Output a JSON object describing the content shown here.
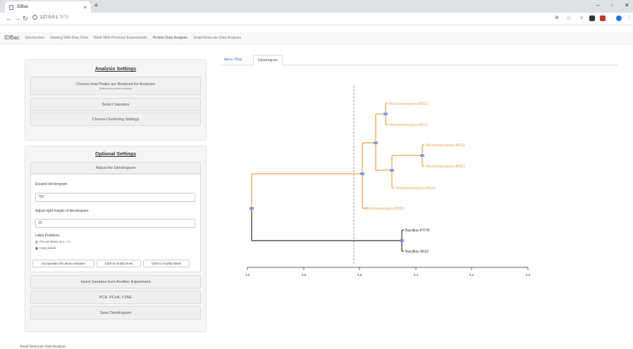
{
  "browser": {
    "tab_title": "IDBac",
    "tab_close": "×",
    "new_tab": "+",
    "url_host": "127.0.0.1",
    "url_port": ":7875",
    "win_min": "–",
    "win_max": "▫",
    "win_close": "✕"
  },
  "navbar": {
    "brand": "IDBac",
    "items": [
      "Introduction",
      "Starting With Raw Data",
      "Work With Previous Experiments",
      "Protein Data Analysis",
      "Small Molecule Data Analysis"
    ]
  },
  "analysis": {
    "title": "Analysis Settings",
    "peaks_btn": "Choose how Peaks are Retained for Analyses",
    "peaks_sub": "(Affects all protein analysis)",
    "select_samples": "Select Samples",
    "clustering": "Choose Clustering Settings"
  },
  "optional": {
    "title": "Optional Settings",
    "adjust": "Adjust the Dendrogram",
    "expand_label": "Expand dendrogram",
    "expand_value": "750",
    "margin_label": "Adjust right margin of dendrogram",
    "margin_value": "20",
    "label_positions": "Label Positions:",
    "radio_plot": "Plot all labels at x = 0",
    "radio_hang": "Hang labels",
    "btn_incorporate": "Incorporate info about samples",
    "btn_lines": "Click to modify lines",
    "btn_labels": "Click to modify labels",
    "insert_samples": "Insert Samples from Another Experiment",
    "pca": "PCA, PCoA, t-SNE",
    "save": "Save Dendrogram"
  },
  "footer_text": "Small Molecule Data Analysis",
  "tabs": {
    "mirror": "Mirror Plots",
    "dendrogram": "Dendrogram"
  },
  "dendrogram": {
    "labels": {
      "b012": "Micromonospora-B012",
      "b011": "Micromonospora-B011",
      "b022": "Micromonospora-B022",
      "b021": "Micromonospora-B021",
      "b020": "Micromonospora-B020",
      "b031": "Micromonospora-B031",
      "py79": "Bacillus-PY79",
      "b3610": "Bacillus-3610"
    },
    "axis_ticks": [
      "1.0",
      "0.8",
      "0.6",
      "0.4",
      "0.2",
      "0.0"
    ],
    "colors": {
      "cluster1": "#f0a04b",
      "cluster2": "#333333",
      "node": "#6f8fe8",
      "cut": "#777777"
    }
  }
}
